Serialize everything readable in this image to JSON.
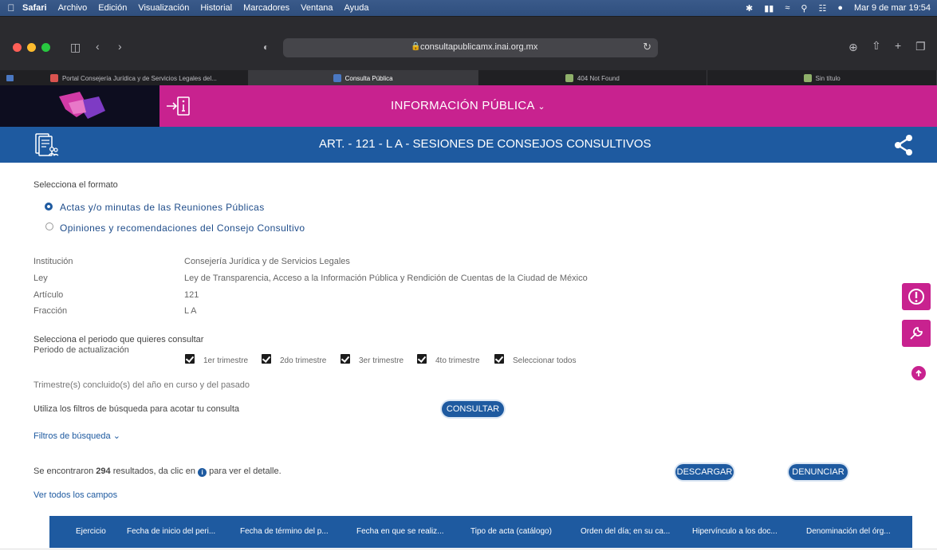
{
  "menubar": {
    "items": [
      "Safari",
      "Archivo",
      "Edición",
      "Visualización",
      "Historial",
      "Marcadores",
      "Ventana",
      "Ayuda"
    ],
    "clock": "Mar 9 de mar  19:54"
  },
  "browser": {
    "url": "consultapublicamx.inai.org.mx",
    "tabs": [
      {
        "label": "Portal Consejería Jurídica y de Servicios Legales del...",
        "active": false,
        "fav_color": "#d9534f"
      },
      {
        "label": "Consulta Pública",
        "active": true,
        "fav_color": "#4a78c2"
      },
      {
        "label": "404 Not Found",
        "active": false,
        "fav_color": "#8fb06a"
      },
      {
        "label": "Sin título",
        "active": false,
        "fav_color": "#8fb06a"
      }
    ]
  },
  "header": {
    "nav_label": "INFORMACIÓN PÚBLICA",
    "page_title": "ART. - 121 - L A - SESIONES DE CONSEJOS CONSULTIVOS"
  },
  "format": {
    "label": "Selecciona el formato",
    "options": [
      {
        "label": "Actas y/o minutas de las Reuniones Públicas",
        "selected": true
      },
      {
        "label": "Opiniones y recomendaciones del Consejo Consultivo",
        "selected": false
      }
    ]
  },
  "details": [
    {
      "key": "Institución",
      "value": "Consejería Jurídica y de Servicios Legales"
    },
    {
      "key": "Ley",
      "value": "Ley de Transparencia, Acceso a la Información Pública y Rendición de Cuentas de la Ciudad de México"
    },
    {
      "key": "Artículo",
      "value": "121"
    },
    {
      "key": "Fracción",
      "value": "L A"
    }
  ],
  "period": {
    "label": "Selecciona el periodo que quieres consultar",
    "update_label": "Periodo de actualización",
    "checks": [
      "1er trimestre",
      "2do trimestre",
      "3er trimestre",
      "4to trimestre",
      "Seleccionar todos"
    ],
    "note": "Trimestre(s) concluido(s) del año en curso y del pasado"
  },
  "filters": {
    "hint": "Utiliza los filtros de búsqueda para acotar tu consulta",
    "consult_button": "CONSULTAR",
    "toggle": "Filtros de búsqueda"
  },
  "results": {
    "prefix": "Se encontraron",
    "count": "294",
    "suffix_a": "resultados, da clic en",
    "suffix_b": "para ver el detalle.",
    "download": "DESCARGAR",
    "report": "DENUNCIAR",
    "all_fields": "Ver todos los campos"
  },
  "table_headers": [
    "Ejercicio",
    "Fecha de inicio del peri...",
    "Fecha de término del p...",
    "Fecha en que se realiz...",
    "Tipo de acta (catálogo)",
    "Orden del día; en su ca...",
    "Hipervínculo a los doc...",
    "Denominación del órg..."
  ],
  "colors": {
    "magenta": "#c8228f",
    "blue": "#1e5aa0"
  }
}
